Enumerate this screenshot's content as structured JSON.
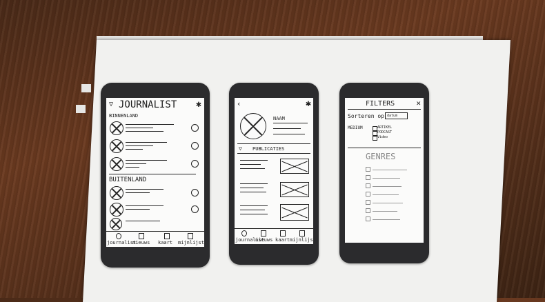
{
  "phone1": {
    "title": "JOURNALIST",
    "section1": "BINNENLAND",
    "section2": "BUITENLAND",
    "nav": [
      "journalist",
      "nieuws",
      "kaart",
      "mijnlijst"
    ]
  },
  "phone2": {
    "name_label": "NAAM",
    "pub_label": "PUBLICATIES",
    "nav": [
      "journalist",
      "nieuws",
      "kaart",
      "mijnlijst"
    ]
  },
  "phone3": {
    "title": "FILTERS",
    "sort_label": "Sorteren op",
    "sort_value": "datum",
    "medium_label": "MEDIUM",
    "medium_options": [
      "ARTIKEL",
      "PODCAST",
      "Video"
    ],
    "genres_label": "GENRES"
  }
}
